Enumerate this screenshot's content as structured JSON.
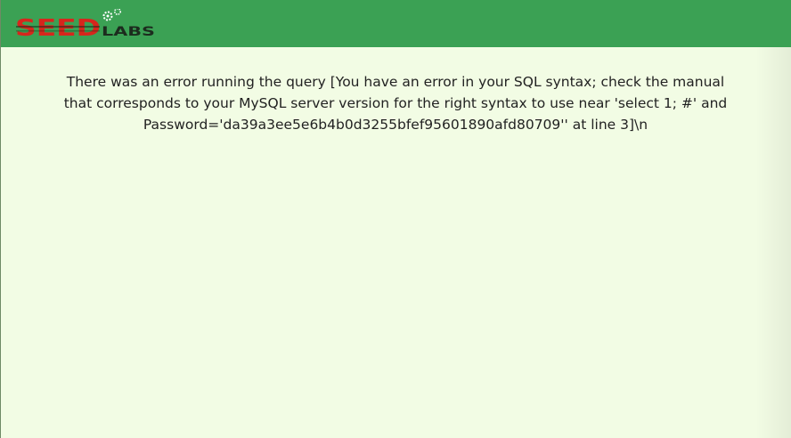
{
  "navbar": {
    "logo": {
      "main_text": "SEED",
      "sub_text": "LABS",
      "colors": {
        "red": "#d7261c",
        "dark": "#1c2c1e",
        "white": "#ffffff"
      }
    },
    "background_color": "#3ba154"
  },
  "page": {
    "background_color": "#f2fce4",
    "error_message": "There was an error running the query [You have an error in your SQL syntax; check the manual that corresponds to your MySQL server version for the right syntax to use near 'select 1; #' and Password='da39a3ee5e6b4b0d3255bfef95601890afd80709'' at line 3]\\n"
  }
}
